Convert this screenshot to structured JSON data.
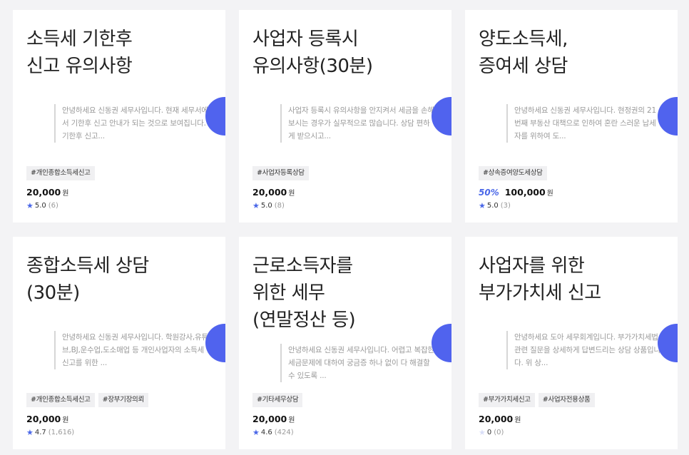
{
  "cards": [
    {
      "title": "소득세 기한후\n신고 유의사항",
      "description": "안녕하세요 신동권 세무사입니다. 현재 세무서에서 기한후 신고 안내가 되는 것으로 보여집니다. 기한후 신고...",
      "tags": [
        "#개인종합소득세신고"
      ],
      "discount": "",
      "price": "20,000",
      "currency": "원",
      "rating": "5.0",
      "review_count": "(6)",
      "star_filled": true
    },
    {
      "title": "사업자 등록시\n유의사항(30분)",
      "description": "사업자 등록시 유의사항을 안지켜서 세금을 손해보시는 경우가 실무적으로 많습니다. 상담 편하게 받으시고...",
      "tags": [
        "#사업자등록상담"
      ],
      "discount": "",
      "price": "20,000",
      "currency": "원",
      "rating": "5.0",
      "review_count": "(8)",
      "star_filled": true
    },
    {
      "title": "양도소득세,\n증여세 상담",
      "description": "안녕하세요 신동권 세무사입니다. 현정권의 21번째 부동산 대책으로 인하여 혼란 스러운 납세자를 위하여 도...",
      "tags": [
        "#상속증여양도세상담"
      ],
      "discount": "50%",
      "price": "100,000",
      "currency": "원",
      "rating": "5.0",
      "review_count": "(3)",
      "star_filled": true
    },
    {
      "title": "종합소득세 상담\n(30분)",
      "description": "안녕하세요 신동권 세무사입니다. 학원강사,유튜브,BJ,운수업,도소매업 등 개인사업자의 소득세 신고를 위한 ...",
      "tags": [
        "#개인종합소득세신고",
        "#장부기장의뢰"
      ],
      "discount": "",
      "price": "20,000",
      "currency": "원",
      "rating": "4.7",
      "review_count": "(1,616)",
      "star_filled": true
    },
    {
      "title": "근로소득자를\n위한 세무\n(연말정산 등)",
      "description": "안녕하세요 신동권 세무사입니다. 어렵고 복잡한 세금문제에 대하여 궁금증 하나 없이 다 해결할 수 있도록 ...",
      "tags": [
        "#기타세무상담"
      ],
      "discount": "",
      "price": "20,000",
      "currency": "원",
      "rating": "4.6",
      "review_count": "(424)",
      "star_filled": true
    },
    {
      "title": "사업자를 위한\n부가가치세 신고",
      "description": "안녕하세요 도아 세무회계입니다. 부가가치세법 관련 질문을 상세하게 답변드리는 상담 상품입니다. 위 상...",
      "tags": [
        "#부가가치세신고",
        "#사업자전용상품"
      ],
      "discount": "",
      "price": "20,000",
      "currency": "원",
      "rating": "0",
      "review_count": "(0)",
      "star_filled": false
    }
  ],
  "icons": {
    "star": "star-icon",
    "accent_color": "#5063ee"
  }
}
